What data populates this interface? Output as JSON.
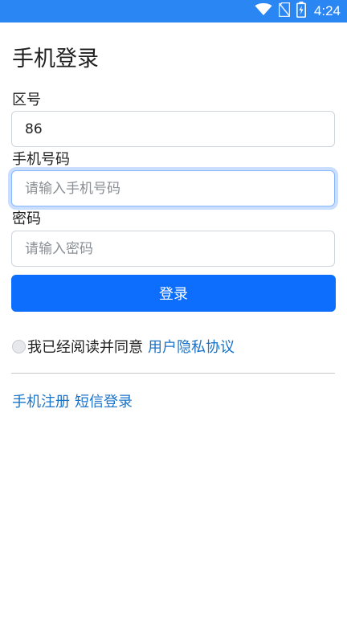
{
  "status_bar": {
    "time": "4:24",
    "icons": [
      "wifi-icon",
      "no-sim-icon",
      "battery-charging-icon"
    ],
    "color": "#2a86f3"
  },
  "page": {
    "title": "手机登录"
  },
  "form": {
    "area_code": {
      "label": "区号",
      "value": "86"
    },
    "phone": {
      "label": "手机号码",
      "placeholder": "请输入手机号码"
    },
    "password": {
      "label": "密码",
      "placeholder": "请输入密码"
    },
    "submit_label": "登录",
    "submit_color": "#0d6efd"
  },
  "agreement": {
    "text": "我已经阅读并同意",
    "link_text": "用户隐私协议",
    "checked": false
  },
  "footer_links": {
    "register": "手机注册",
    "sms_login": "短信登录"
  },
  "link_color": "#1a73c8"
}
